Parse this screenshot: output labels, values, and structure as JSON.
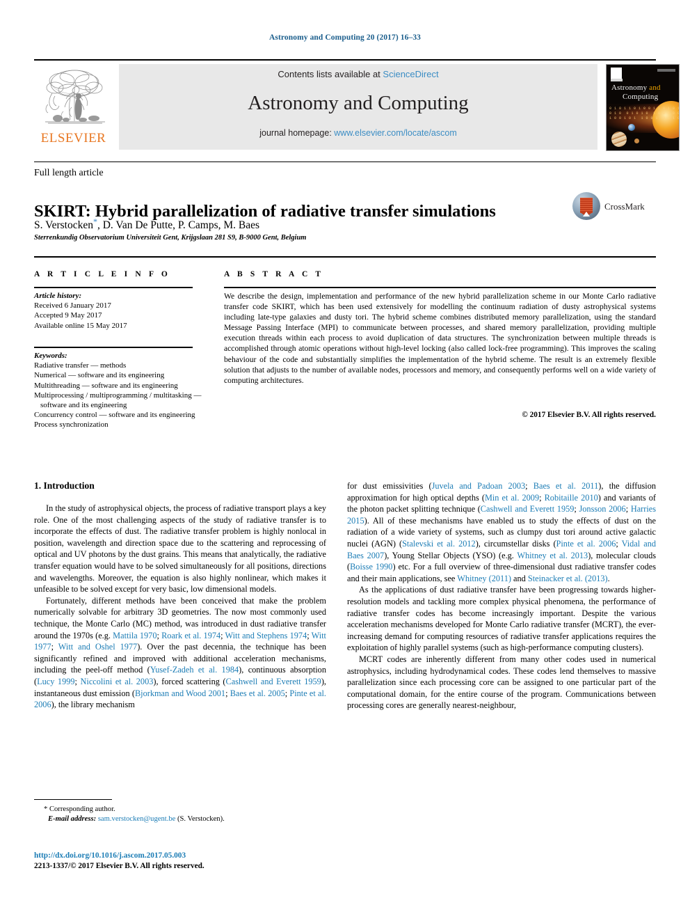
{
  "running_head": "Astronomy and Computing 20 (2017) 16–33",
  "masthead": {
    "publisher_word": "ELSEVIER",
    "contents_prefix": "Contents lists available at ",
    "contents_link": "ScienceDirect",
    "journal_title": "Astronomy and Computing",
    "homepage_prefix": "journal homepage: ",
    "homepage_url": "www.elsevier.com/locate/ascom"
  },
  "cover": {
    "title_line1": "Astronomy",
    "title_highlight": "and",
    "title_line2": "Computing",
    "bits": "0 1 0 1 1 0 1 0 0 1 1 0 1 0 1 1\n0 1 0  0 1 0 1 0  1 0 0 1 0 0 0 1\n1 0 0 1 0 1  1 0 0 1  0 1 1 0 1 0"
  },
  "article": {
    "type": "Full length article",
    "title": "SKIRT: Hybrid parallelization of radiative transfer simulations",
    "authors": "S. Verstocken",
    "authors_rest": ", D. Van De Putte, P. Camps, M. Baes",
    "corresponding_marker": "*",
    "affiliation": "Sterrenkundig Observatorium Universiteit Gent, Krijgslaan 281 S9, B-9000 Gent, Belgium"
  },
  "crossmark": {
    "label": "CrossMark"
  },
  "info": {
    "heading": "A R T I C L E  I N F O",
    "history_label": "Article history:",
    "history": [
      "Received 6 January 2017",
      "Accepted 9 May 2017",
      "Available online 15 May 2017"
    ],
    "keywords_label": "Keywords:",
    "keywords": [
      "Radiative transfer — methods",
      "Numerical — software and its engineering",
      "Multithreading — software and its engineering",
      "Multiprocessing / multiprogramming / multitasking — software and its engineering",
      "Concurrency control — software and its engineering",
      "Process synchronization"
    ]
  },
  "abstract": {
    "heading": "A B S T R A C T",
    "text": "We describe the design, implementation and performance of the new hybrid parallelization scheme in our Monte Carlo radiative transfer code SKIRT, which has been used extensively for modelling the continuum radiation of dusty astrophysical systems including late-type galaxies and dusty tori. The hybrid scheme combines distributed memory parallelization, using the standard Message Passing Interface (MPI) to communicate between processes, and shared memory parallelization, providing multiple execution threads within each process to avoid duplication of data structures. The synchronization between multiple threads is accomplished through atomic operations without high-level locking (also called lock-free programming). This improves the scaling behaviour of the code and substantially simplifies the implementation of the hybrid scheme. The result is an extremely flexible solution that adjusts to the number of available nodes, processors and memory, and consequently performs well on a wide variety of computing architectures.",
    "copyright": "© 2017 Elsevier B.V. All rights reserved."
  },
  "body": {
    "section_number_title": "1.  Introduction",
    "left_p1": "In the study of astrophysical objects, the process of radiative transport plays a key role. One of the most challenging aspects of the study of radiative transfer is to incorporate the effects of dust. The radiative transfer problem is highly nonlocal in position, wavelength and direction space due to the scattering and reprocessing of optical and UV photons by the dust grains. This means that analytically, the radiative transfer equation would have to be solved simultaneously for all positions, directions and wavelengths. Moreover, the equation is also highly nonlinear, which makes it unfeasible to be solved except for very basic, low dimensional models.",
    "left_p2_parts": [
      {
        "t": "Fortunately, different methods have been conceived that make the problem numerically solvable for arbitrary 3D geometries. The now most commonly used technique, the Monte Carlo (MC) method, was introduced in dust radiative transfer around the 1970s (e.g. ",
        "ref": false
      },
      {
        "t": "Mattila 1970",
        "ref": true
      },
      {
        "t": "; ",
        "ref": false
      },
      {
        "t": "Roark et al. 1974",
        "ref": true
      },
      {
        "t": "; ",
        "ref": false
      },
      {
        "t": "Witt and Stephens 1974",
        "ref": true
      },
      {
        "t": "; ",
        "ref": false
      },
      {
        "t": "Witt 1977",
        "ref": true
      },
      {
        "t": "; ",
        "ref": false
      },
      {
        "t": "Witt and Oshel 1977",
        "ref": true
      },
      {
        "t": "). Over the past decennia, the technique has been significantly refined and improved with additional acceleration mechanisms, including the peel-off method  (",
        "ref": false
      },
      {
        "t": "Yusef-Zadeh et al. 1984",
        "ref": true
      },
      {
        "t": "), continuous absorption (",
        "ref": false
      },
      {
        "t": "Lucy 1999",
        "ref": true
      },
      {
        "t": "; ",
        "ref": false
      },
      {
        "t": "Niccolini et al. 2003",
        "ref": true
      },
      {
        "t": "), forced scattering  (",
        "ref": false
      },
      {
        "t": "Cashwell and Everett 1959",
        "ref": true
      },
      {
        "t": "), instantaneous dust emission (",
        "ref": false
      },
      {
        "t": "Bjorkman and Wood 2001",
        "ref": true
      },
      {
        "t": "; ",
        "ref": false
      },
      {
        "t": "Baes et al. 2005",
        "ref": true
      },
      {
        "t": "; ",
        "ref": false
      },
      {
        "t": "Pinte et al. 2006",
        "ref": true
      },
      {
        "t": "), the library mechanism",
        "ref": false
      }
    ],
    "right_p1_parts": [
      {
        "t": "for dust emissivities (",
        "ref": false
      },
      {
        "t": "Juvela and Padoan 2003",
        "ref": true
      },
      {
        "t": "; ",
        "ref": false
      },
      {
        "t": "Baes et al. 2011",
        "ref": true
      },
      {
        "t": "), the diffusion approximation for high optical depths  (",
        "ref": false
      },
      {
        "t": "Min et al. 2009",
        "ref": true
      },
      {
        "t": "; ",
        "ref": false
      },
      {
        "t": "Robitaille 2010",
        "ref": true
      },
      {
        "t": ") and variants of the photon packet splitting technique (",
        "ref": false
      },
      {
        "t": "Cashwell and Everett 1959",
        "ref": true
      },
      {
        "t": "; ",
        "ref": false
      },
      {
        "t": "Jonsson 2006",
        "ref": true
      },
      {
        "t": "; ",
        "ref": false
      },
      {
        "t": "Harries 2015",
        "ref": true
      },
      {
        "t": "). All of these mechanisms have enabled us to study the effects of dust on the radiation of a wide variety of systems, such as clumpy dust tori around active galactic nuclei (AGN) (",
        "ref": false
      },
      {
        "t": "Stalevski et al. 2012",
        "ref": true
      },
      {
        "t": "), circumstellar disks (",
        "ref": false
      },
      {
        "t": "Pinte et al. 2006",
        "ref": true
      },
      {
        "t": "; ",
        "ref": false
      },
      {
        "t": "Vidal and Baes 2007",
        "ref": true
      },
      {
        "t": "), Young Stellar Objects (YSO) (e.g. ",
        "ref": false
      },
      {
        "t": "Whitney et al. 2013",
        "ref": true
      },
      {
        "t": "), molecular clouds (",
        "ref": false
      },
      {
        "t": "Boisse 1990",
        "ref": true
      },
      {
        "t": ") etc. For a full overview of three-dimensional dust radiative transfer codes and their main applications, see  ",
        "ref": false
      },
      {
        "t": "Whitney (2011)",
        "ref": true
      },
      {
        "t": " and ",
        "ref": false
      },
      {
        "t": "Steinacker et al. (2013)",
        "ref": true
      },
      {
        "t": ".",
        "ref": false
      }
    ],
    "right_p2": "As the applications of dust radiative transfer have been progressing towards higher-resolution models and tackling more complex physical phenomena, the performance of radiative transfer codes has become increasingly important. Despite the various acceleration mechanisms developed for Monte Carlo radiative transfer (MCRT), the ever-increasing demand for computing resources of radiative transfer applications requires the exploitation of highly parallel systems (such as high-performance computing clusters).",
    "right_p3": "MCRT codes are inherently different from many other codes used in numerical astrophysics, including hydrodynamical codes. These codes lend themselves to massive parallelization since each processing core can be assigned to one particular part of the computational domain, for the entire course of the program. Communications between processing cores are generally nearest-neighbour,"
  },
  "footer": {
    "corresponding": "* Corresponding author.",
    "email_label": "E-mail address:",
    "email": "sam.verstocken@ugent.be",
    "email_suffix": "(S. Verstocken).",
    "doi": "http://dx.doi.org/10.1016/j.ascom.2017.05.003",
    "issn_line": "2213-1337/© 2017 Elsevier B.V. All rights reserved."
  },
  "colors": {
    "link_blue": "#1b7cb5",
    "header_blue": "#1b5e8c",
    "sciencedirect_blue": "#3b8dc4",
    "elsevier_orange": "#E87722",
    "panel_gray": "#e8e8e8"
  }
}
